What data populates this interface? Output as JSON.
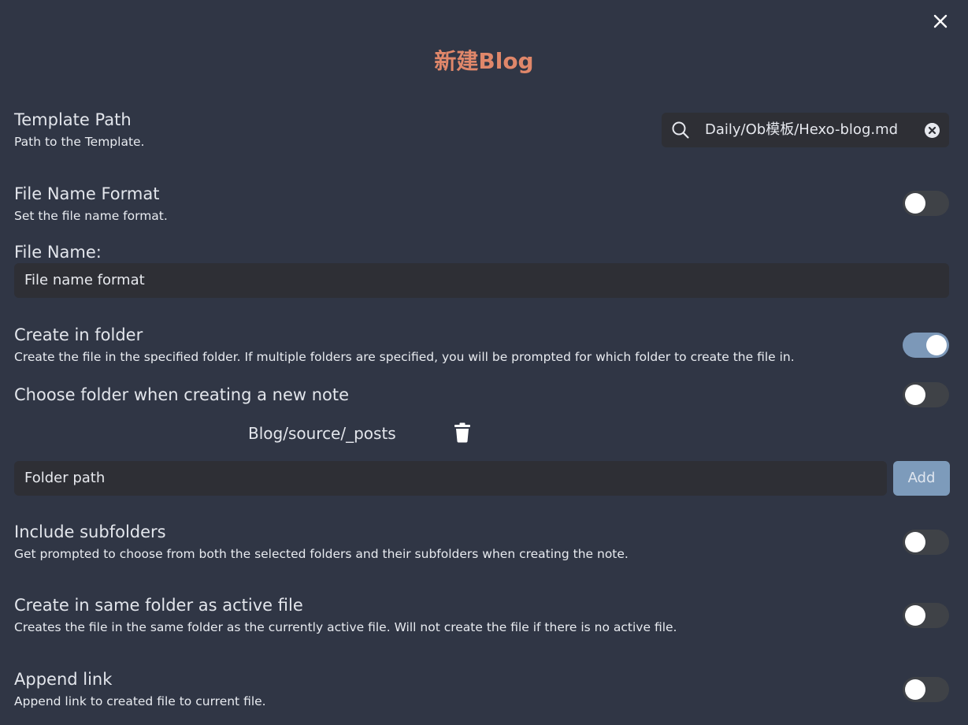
{
  "modal": {
    "title": "新建Blog",
    "close_icon": "close-icon"
  },
  "template_path": {
    "name": "Template Path",
    "description": "Path to the Template.",
    "value": "Daily/Ob模板/Hexo-blog.md",
    "search_icon": "search-icon",
    "clear_icon": "clear-icon"
  },
  "file_name_format": {
    "name": "File Name Format",
    "description": "Set the file name format.",
    "enabled": false
  },
  "file_name": {
    "label": "File Name:",
    "placeholder": "File name format"
  },
  "create_in_folder": {
    "name": "Create in folder",
    "description": "Create the file in the specified folder. If multiple folders are specified, you will be prompted for which folder to create the file in.",
    "enabled": true
  },
  "choose_folder": {
    "name": "Choose folder when creating a new note",
    "enabled": false
  },
  "folders": {
    "items": [
      "Blog/source/_posts"
    ],
    "delete_icon": "trash-icon",
    "input_placeholder": "Folder path",
    "add_label": "Add"
  },
  "include_subfolders": {
    "name": "Include subfolders",
    "description": "Get prompted to choose from both the selected folders and their subfolders when creating the note.",
    "enabled": false
  },
  "same_folder": {
    "name": "Create in same folder as active file",
    "description": "Creates the file in the same folder as the currently active file. Will not create the file if there is no active file.",
    "enabled": false
  },
  "append_link": {
    "name": "Append link",
    "description": "Append link to created file to current file.",
    "enabled": false
  },
  "colors": {
    "background": "#303645",
    "title": "#e0876a",
    "toggle_on": "#7c98b8",
    "toggle_off": "#3f4247",
    "input_bg": "#2e2f35",
    "add_button": "#7d9bbb"
  }
}
